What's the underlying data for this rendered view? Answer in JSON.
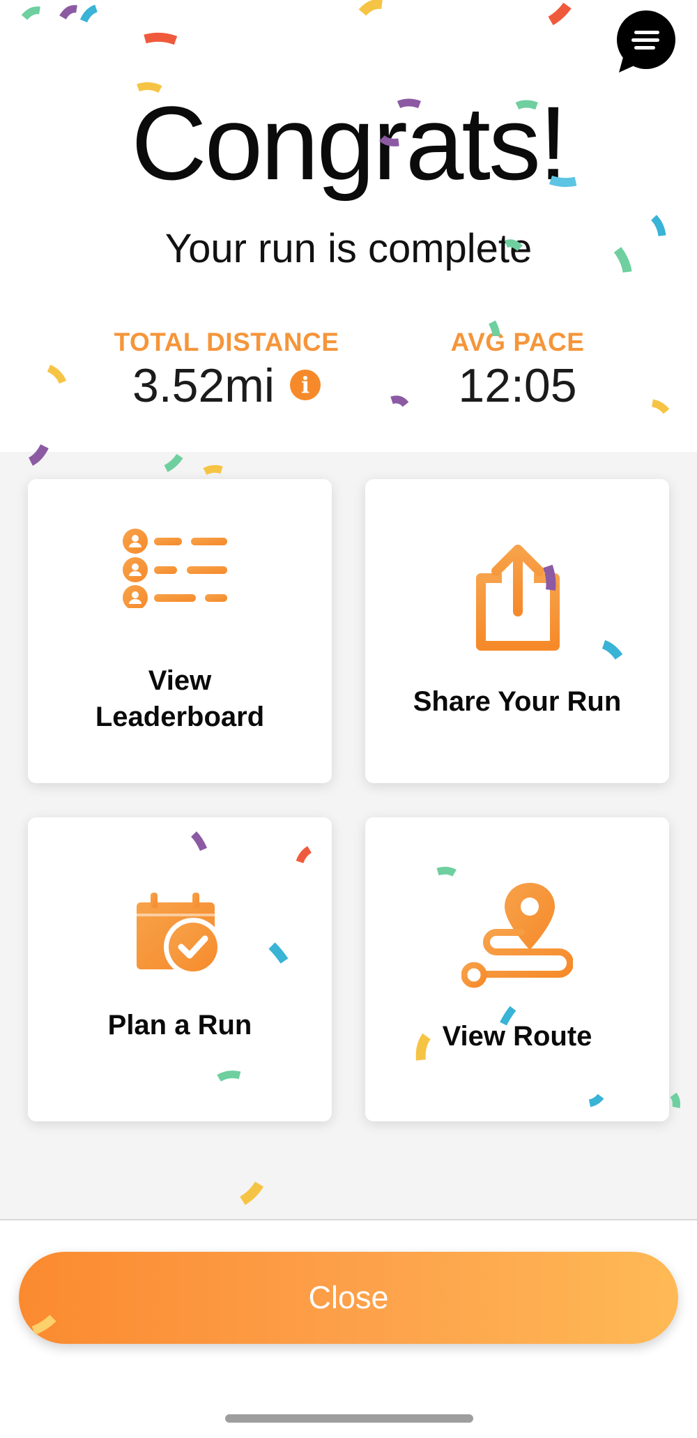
{
  "header": {
    "title": "Congrats!",
    "subtitle": "Your run is complete"
  },
  "stats": {
    "distance_label": "TOTAL DISTANCE",
    "distance_value": "3.52mi",
    "pace_label": "AVG PACE",
    "pace_value": "12:05"
  },
  "actions": {
    "leaderboard": "View\nLeaderboard",
    "share": "Share Your Run",
    "plan": "Plan a Run",
    "route": "View Route"
  },
  "footer": {
    "close_label": "Close"
  },
  "colors": {
    "accent": "#f68a2a",
    "accent_light": "#feb955",
    "grid_bg": "#f4f4f4"
  },
  "icons": [
    "chat-icon",
    "info-icon",
    "leaderboard-icon",
    "share-icon",
    "calendar-check-icon",
    "route-pin-icon"
  ]
}
